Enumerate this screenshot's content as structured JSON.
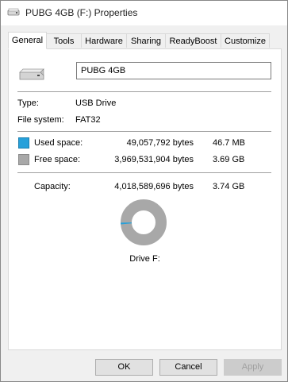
{
  "window": {
    "title": "PUBG 4GB (F:) Properties"
  },
  "tabs": [
    {
      "label": "General",
      "active": true
    },
    {
      "label": "Tools"
    },
    {
      "label": "Hardware"
    },
    {
      "label": "Sharing"
    },
    {
      "label": "ReadyBoost"
    },
    {
      "label": "Customize"
    }
  ],
  "general": {
    "volume_name": "PUBG 4GB",
    "type_label": "Type:",
    "type_value": "USB Drive",
    "fs_label": "File system:",
    "fs_value": "FAT32",
    "used": {
      "label": "Used space:",
      "bytes": "49,057,792 bytes",
      "size": "46.7 MB",
      "color": "#26a0da"
    },
    "free": {
      "label": "Free space:",
      "bytes": "3,969,531,904 bytes",
      "size": "3.69 GB",
      "color": "#a8a8a8"
    },
    "capacity": {
      "label": "Capacity:",
      "bytes": "4,018,589,696 bytes",
      "size": "3.74 GB"
    },
    "used_fraction": 0.0122,
    "drive_label": "Drive F:"
  },
  "buttons": {
    "ok": "OK",
    "cancel": "Cancel",
    "apply": "Apply"
  },
  "icons": {
    "title": "usb-drive-icon",
    "drive": "usb-drive-icon"
  }
}
